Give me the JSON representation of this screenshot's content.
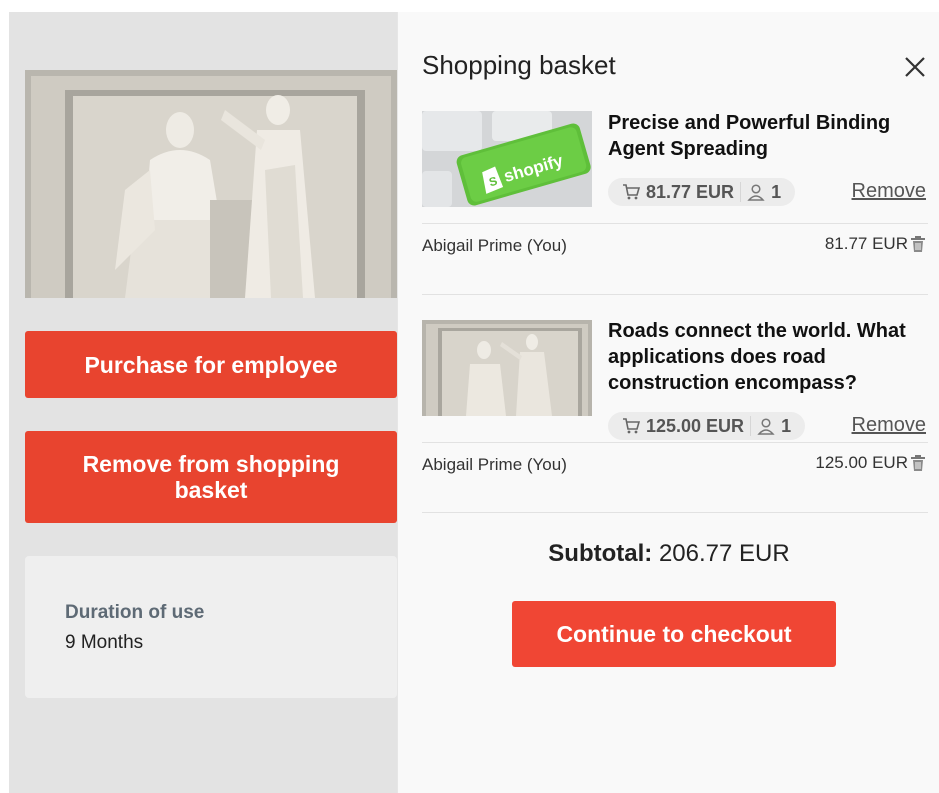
{
  "left_page": {
    "purchase_button": "Purchase for employee",
    "remove_button": "Remove from shopping basket",
    "duration": {
      "label": "Duration of use",
      "value": "9 Months"
    }
  },
  "basket": {
    "title": "Shopping basket",
    "items": [
      {
        "title": "Precise and Powerful Binding Agent Spreading",
        "price": "81.77 EUR",
        "quantity": "1",
        "remove_label": "Remove",
        "owner": "Abigail Prime (You)",
        "line_total": "81.77 EUR",
        "thumb_text": "shopify"
      },
      {
        "title": "Roads connect the world. What applications does road construction encompass?",
        "price": "125.00 EUR",
        "quantity": "1",
        "remove_label": "Remove",
        "owner": "Abigail Prime (You)",
        "line_total": "125.00 EUR"
      }
    ],
    "subtotal_label": "Subtotal:",
    "subtotal_value": "206.77 EUR",
    "checkout_button": "Continue to checkout"
  },
  "colors": {
    "accent": "#e8442f",
    "checkout": "#f04634",
    "shopify_green": "#5fbf3a"
  },
  "icons": [
    "cart-icon",
    "user-icon",
    "trash-icon",
    "close-icon",
    "shopify-bag-icon"
  ]
}
